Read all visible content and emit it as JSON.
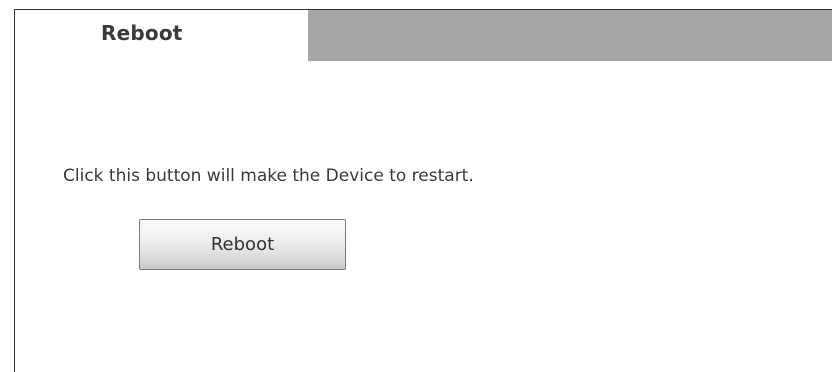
{
  "tab": {
    "title": "Reboot"
  },
  "main": {
    "description": "Click this button will make the Device to restart.",
    "reboot_button_label": "Reboot"
  },
  "colors": {
    "tab_bar": "#a6a6a6",
    "text": "#3a3a3a",
    "frame_border": "#333333"
  }
}
